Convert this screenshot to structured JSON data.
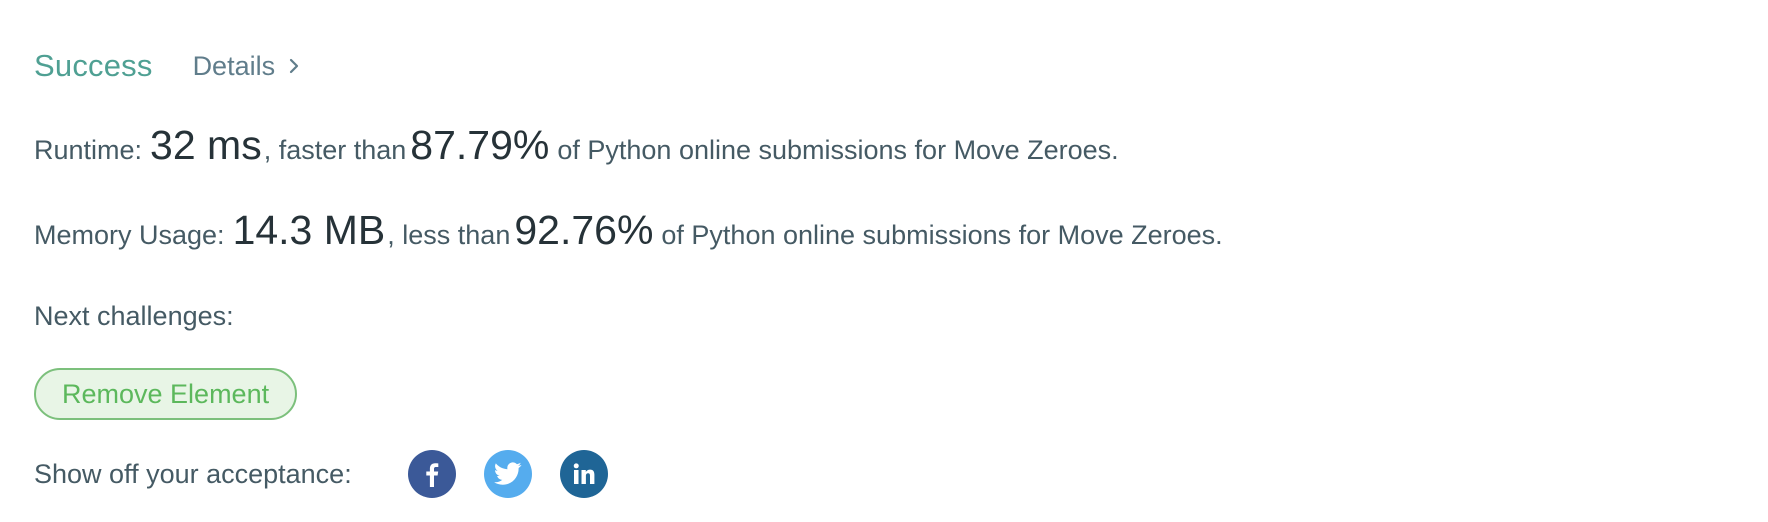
{
  "status": {
    "title": "Success",
    "details_label": "Details"
  },
  "runtime": {
    "label": "Runtime:",
    "value": "32 ms",
    "comparator": ", faster than",
    "percent": "87.79%",
    "suffix": "of Python online submissions for Move Zeroes."
  },
  "memory": {
    "label": "Memory Usage:",
    "value": "14.3 MB",
    "comparator": ", less than",
    "percent": "92.76%",
    "suffix": "of Python online submissions for Move Zeroes."
  },
  "next_challenges": {
    "label": "Next challenges:",
    "items": [
      "Remove Element"
    ]
  },
  "share": {
    "label": "Show off your acceptance:",
    "networks": [
      {
        "name": "facebook",
        "icon": "facebook-icon",
        "color": "#3b5998"
      },
      {
        "name": "twitter",
        "icon": "twitter-icon",
        "color": "#55acee"
      },
      {
        "name": "linkedin",
        "icon": "linkedin-icon",
        "color": "#1f6596"
      }
    ]
  },
  "colors": {
    "success": "#4fa093",
    "challenge_border": "#7cc07c",
    "challenge_bg": "#e8f5e6",
    "challenge_text": "#5cb85c"
  }
}
